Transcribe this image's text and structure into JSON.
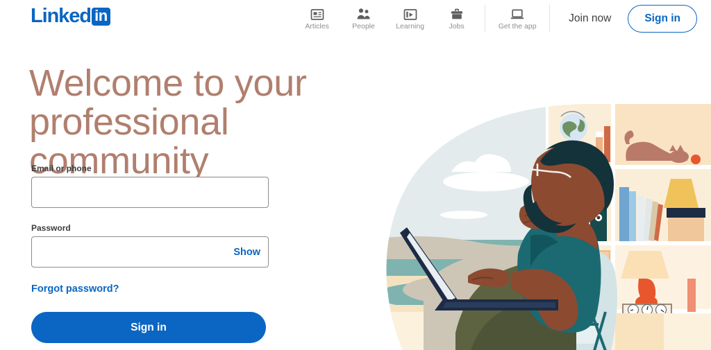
{
  "brand": {
    "name_word": "Linked",
    "name_badge": "in",
    "color": "#0a66c2"
  },
  "header": {
    "nav_items": [
      {
        "label": "Articles",
        "icon": "articles-icon"
      },
      {
        "label": "People",
        "icon": "people-icon"
      },
      {
        "label": "Learning",
        "icon": "learning-icon"
      },
      {
        "label": "Jobs",
        "icon": "jobs-icon"
      },
      {
        "label": "Get the app",
        "icon": "get-the-app-icon"
      }
    ],
    "join_now": "Join now",
    "sign_in": "Sign in",
    "nav_label_color": "#8f8f8f"
  },
  "hero": {
    "title": "Welcome to your professional community",
    "title_color": "#b07f6e"
  },
  "form": {
    "email_label": "Email or phone",
    "email_value": "",
    "email_placeholder": "",
    "password_label": "Password",
    "password_value": "",
    "password_placeholder": "",
    "show_label": "Show",
    "forgot_label": "Forgot password?",
    "submit_label": "Sign in",
    "link_color": "#0a66c2",
    "button_color": "#0a66c2"
  },
  "illustration": {
    "name": "person-working-on-laptop-illustration",
    "palette": {
      "sky": "#e3ebec",
      "cloud": "#ffffff",
      "sea": "#7fb3b0",
      "sand": "#f7e7c8",
      "beach": "#fdf0d8",
      "hill": "#cdc6b6",
      "skin": "#8c4a31",
      "hair": "#14323a",
      "shirt": "#1b6a72",
      "pants": "#5d6341",
      "laptop": "#1d2b45",
      "chair": "#d3e3e6",
      "shelf_bg": "#fbeed9",
      "shelf_alt": "#fae3c3",
      "globe_land": "#6f9264",
      "globe_water": "#d6e6f2",
      "cat": "#b97a6a",
      "lamp_base": "#e8562e",
      "binder_green": "#9fb99a",
      "binder_dark": "#164a4d",
      "book_blue": "#6fa5cf",
      "book_orange": "#cf6a47"
    }
  }
}
